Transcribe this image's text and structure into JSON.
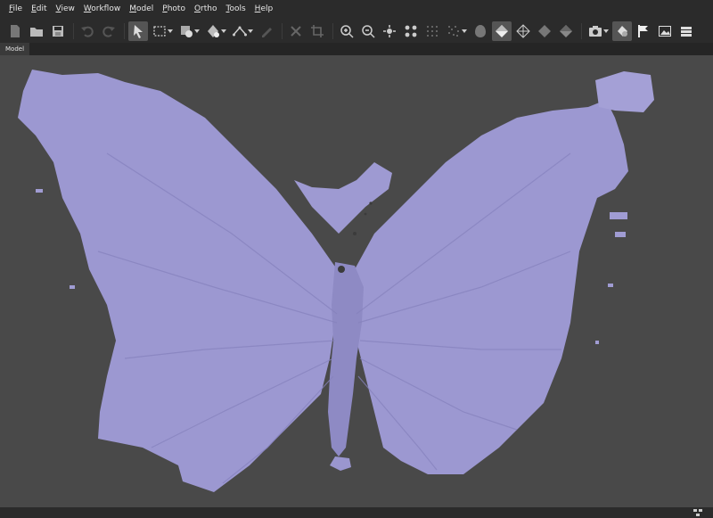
{
  "menu": [
    {
      "pre": "",
      "u": "F",
      "post": "ile"
    },
    {
      "pre": "",
      "u": "E",
      "post": "dit"
    },
    {
      "pre": "",
      "u": "V",
      "post": "iew"
    },
    {
      "pre": "",
      "u": "W",
      "post": "orkflow"
    },
    {
      "pre": "",
      "u": "M",
      "post": "odel"
    },
    {
      "pre": "",
      "u": "P",
      "post": "hoto"
    },
    {
      "pre": "",
      "u": "O",
      "post": "rtho"
    },
    {
      "pre": "",
      "u": "T",
      "post": "ools"
    },
    {
      "pre": "",
      "u": "H",
      "post": "elp"
    }
  ],
  "tab": {
    "label": "Model"
  },
  "colors": {
    "chrome": "#2b2b2b",
    "viewport": "#494949",
    "model_fill": "#9b97cf",
    "model_shadow": "#7f7bb6",
    "icon": "#cfcfcf",
    "icon_dim": "#777777"
  },
  "viewport": {
    "model": "butterfly mesh (solid shaded)"
  }
}
